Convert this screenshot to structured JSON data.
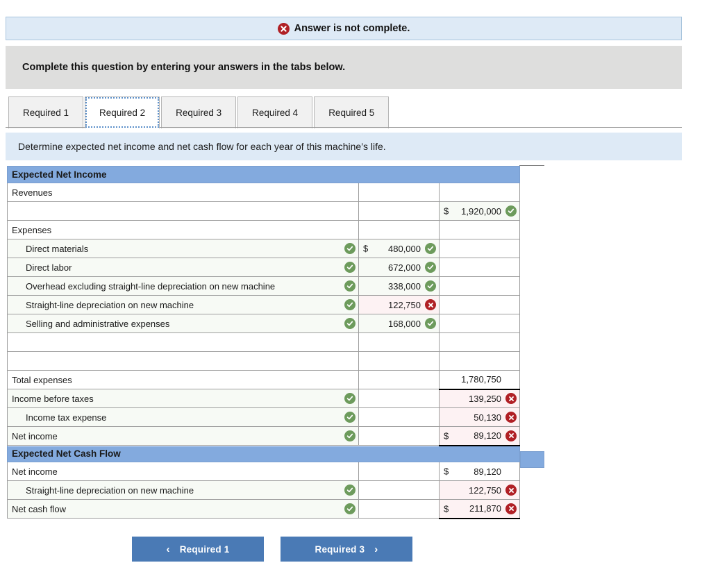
{
  "alert": {
    "icon": "x-circle-icon",
    "text": "Answer is not complete."
  },
  "instruction": {
    "text": "Complete this question by entering your answers in the tabs below."
  },
  "tabs": [
    {
      "label": "Required 1",
      "active": false
    },
    {
      "label": "Required 2",
      "active": true
    },
    {
      "label": "Required 3",
      "active": false
    },
    {
      "label": "Required 4",
      "active": false
    },
    {
      "label": "Required 5",
      "active": false
    }
  ],
  "prompt": {
    "text": "Determine expected net income and net cash flow for each year of this machine’s life."
  },
  "sheet": {
    "section_net_income_title": "Expected Net Income",
    "section_cash_flow_title": "Expected Net Cash Flow",
    "rows": [
      {
        "label": "Revenues",
        "mid": "",
        "right": ""
      },
      {
        "label": "",
        "mid": "",
        "right": "1,920,000",
        "right_dollar": true,
        "right_status": "ok"
      },
      {
        "label": "Expenses",
        "mid": "",
        "right": ""
      },
      {
        "label": "Direct materials",
        "label_status": "ok",
        "mid": "480,000",
        "mid_dollar": true,
        "mid_status": "ok",
        "right": ""
      },
      {
        "label": "Direct labor",
        "label_status": "ok",
        "mid": "672,000",
        "mid_status": "ok",
        "right": ""
      },
      {
        "label": "Overhead excluding straight-line depreciation on new machine",
        "label_status": "ok",
        "mid": "338,000",
        "mid_status": "ok",
        "right": ""
      },
      {
        "label": "Straight-line depreciation on new machine",
        "label_status": "ok",
        "mid": "122,750",
        "mid_status": "bad",
        "right": ""
      },
      {
        "label": "Selling and administrative expenses",
        "label_status": "ok",
        "mid": "168,000",
        "mid_status": "ok",
        "right": ""
      },
      {
        "label": "",
        "mid": "",
        "right": ""
      },
      {
        "label": "",
        "mid": "",
        "right": ""
      },
      {
        "label": "Total expenses",
        "mid": "",
        "right": "1,780,750"
      },
      {
        "label": "Income before taxes",
        "label_status": "ok",
        "mid": "",
        "right": "139,250",
        "right_status": "bad"
      },
      {
        "label": "Income tax expense",
        "label_status": "ok",
        "mid": "",
        "right": "50,130",
        "right_status": "bad"
      },
      {
        "label": "Net income",
        "label_status": "ok",
        "mid": "",
        "right": "89,120",
        "right_dollar": true,
        "right_status": "bad"
      }
    ],
    "cash_rows": [
      {
        "label": "Net income",
        "mid": "",
        "right": "89,120",
        "right_dollar": true
      },
      {
        "label": "Straight-line depreciation on new machine",
        "label_status": "ok",
        "mid": "",
        "right": "122,750",
        "right_status": "bad"
      },
      {
        "label": "Net cash flow",
        "label_status": "ok",
        "mid": "",
        "right": "211,870",
        "right_dollar": true,
        "right_status": "bad"
      }
    ]
  },
  "nav": {
    "prev_label": "Required 1",
    "next_label": "Required 3",
    "prev_chevron": "‹",
    "next_chevron": "›"
  },
  "colors": {
    "alert_bg": "#deeaf6",
    "instruction_bg": "#dededd",
    "section_header_bg": "#83aade",
    "button_bg": "#4a7ab5",
    "ok_green": "#6d9b5c",
    "bad_red": "#b02025"
  }
}
